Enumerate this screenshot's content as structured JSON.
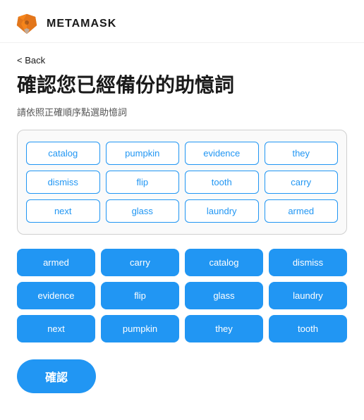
{
  "app": {
    "logo_text": "METAMASK"
  },
  "nav": {
    "back_label": "Back"
  },
  "page": {
    "title": "確認您已經備份的助憶詞",
    "subtitle": "請依照正確順序點選助憶詞"
  },
  "word_pool": {
    "words": [
      {
        "id": "catalog",
        "label": "catalog",
        "empty": false
      },
      {
        "id": "pumpkin",
        "label": "pumpkin",
        "empty": false
      },
      {
        "id": "evidence",
        "label": "evidence",
        "empty": false
      },
      {
        "id": "they",
        "label": "they",
        "empty": false
      },
      {
        "id": "dismiss",
        "label": "dismiss",
        "empty": false
      },
      {
        "id": "flip",
        "label": "flip",
        "empty": false
      },
      {
        "id": "tooth",
        "label": "tooth",
        "empty": false
      },
      {
        "id": "carry",
        "label": "carry",
        "empty": false
      },
      {
        "id": "next",
        "label": "next",
        "empty": false
      },
      {
        "id": "glass",
        "label": "glass",
        "empty": false
      },
      {
        "id": "laundry",
        "label": "laundry",
        "empty": false
      },
      {
        "id": "armed",
        "label": "armed",
        "empty": false
      }
    ]
  },
  "answer_area": {
    "words": [
      {
        "id": "armed2",
        "label": "armed"
      },
      {
        "id": "carry2",
        "label": "carry"
      },
      {
        "id": "catalog2",
        "label": "catalog"
      },
      {
        "id": "dismiss2",
        "label": "dismiss"
      },
      {
        "id": "evidence2",
        "label": "evidence"
      },
      {
        "id": "flip2",
        "label": "flip"
      },
      {
        "id": "glass2",
        "label": "glass"
      },
      {
        "id": "laundry2",
        "label": "laundry"
      },
      {
        "id": "next2",
        "label": "next"
      },
      {
        "id": "pumpkin2",
        "label": "pumpkin"
      },
      {
        "id": "they2",
        "label": "they"
      },
      {
        "id": "tooth2",
        "label": "tooth"
      }
    ]
  },
  "actions": {
    "confirm_label": "確認"
  }
}
